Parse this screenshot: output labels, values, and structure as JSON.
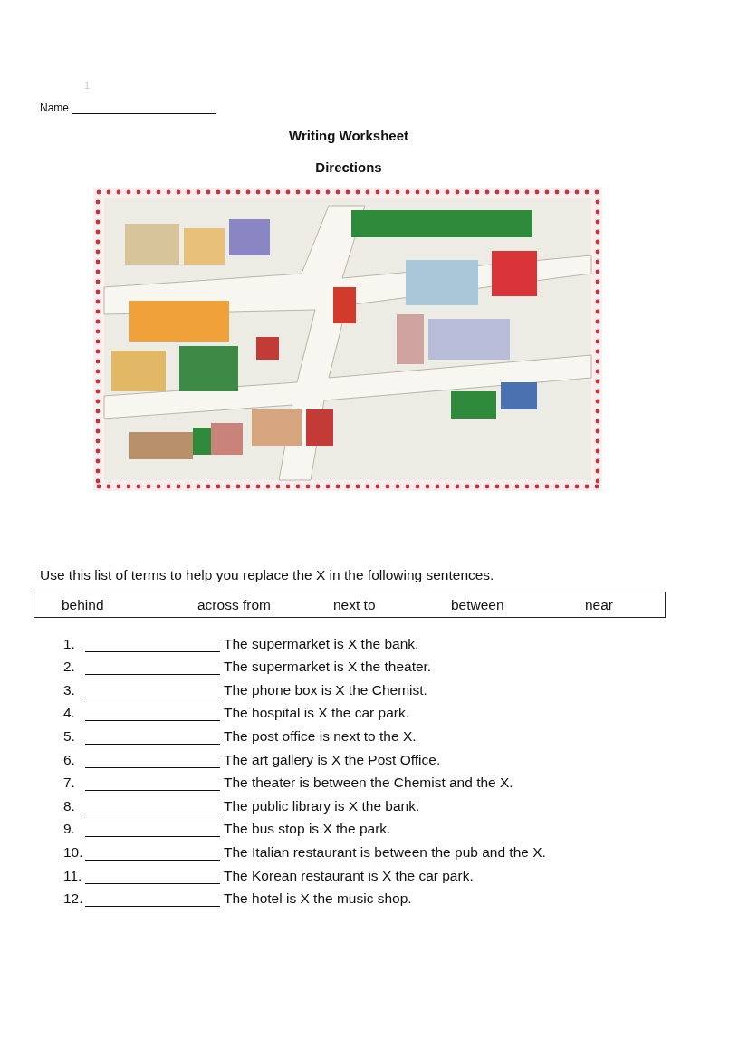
{
  "page_number": "1",
  "name_label": "Name",
  "title": "Writing Worksheet",
  "subtitle": "Directions",
  "instruction": "Use this list of terms to help you replace the X in the following sentences.",
  "terms": [
    "behind",
    "across from",
    "next to",
    "between",
    "near"
  ],
  "questions": [
    {
      "number": "1.",
      "sentence": "The supermarket is X the bank."
    },
    {
      "number": "2.",
      "sentence": "The supermarket is X the theater."
    },
    {
      "number": "3.",
      "sentence": "The phone box is X the Chemist."
    },
    {
      "number": "4.",
      "sentence": "The hospital is X the car park."
    },
    {
      "number": "5.",
      "sentence": "The post office is next to the X."
    },
    {
      "number": "6.",
      "sentence": "The art gallery is X the Post Office."
    },
    {
      "number": "7.",
      "sentence": "The theater is between the Chemist and the X."
    },
    {
      "number": "8.",
      "sentence": "The public library is X the bank."
    },
    {
      "number": "9.",
      "sentence": "The bus stop is X the park."
    },
    {
      "number": "10.",
      "sentence": "The Italian restaurant is between the pub and the X."
    },
    {
      "number": "11.",
      "sentence": "The Korean restaurant is X the car park."
    },
    {
      "number": "12.",
      "sentence": "The hotel is X the music shop."
    }
  ]
}
